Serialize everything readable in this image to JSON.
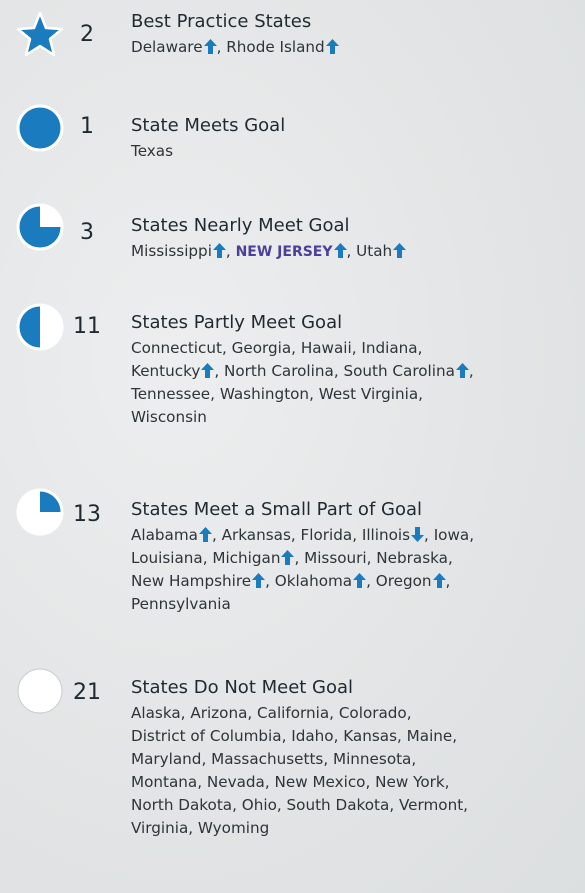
{
  "colors": {
    "accent": "#1a7bbf",
    "highlight": "#4b3f9a",
    "text": "#2d3539"
  },
  "groups": [
    {
      "icon": "star-icon",
      "count": "2",
      "title": "Best Practice States",
      "states": [
        {
          "name": "Delaware",
          "arrow": "up"
        },
        {
          "sep": ", "
        },
        {
          "name": "Rhode Island",
          "arrow": "up"
        }
      ]
    },
    {
      "icon": "full-circle-icon",
      "count": "1",
      "title": "State Meets Goal",
      "states": [
        {
          "name": "Texas"
        }
      ]
    },
    {
      "icon": "three-quarter-circle-icon",
      "count": "3",
      "title": "States Nearly Meet Goal",
      "states": [
        {
          "name": "Mississippi",
          "arrow": "up"
        },
        {
          "sep": ", "
        },
        {
          "name": "NEW JERSEY",
          "arrow": "up",
          "highlight": true
        },
        {
          "sep": ", "
        },
        {
          "name": "Utah",
          "arrow": "up"
        }
      ]
    },
    {
      "icon": "half-circle-icon",
      "count": "11",
      "title": "States Partly Meet Goal",
      "states": [
        {
          "name": "Connecticut"
        },
        {
          "sep": ", "
        },
        {
          "name": "Georgia"
        },
        {
          "sep": ", "
        },
        {
          "name": "Hawaii"
        },
        {
          "sep": ", "
        },
        {
          "name": "Indiana"
        },
        {
          "sep": ","
        },
        {
          "br": true
        },
        {
          "name": "Kentucky",
          "arrow": "up"
        },
        {
          "sep": ", "
        },
        {
          "name": "North Carolina"
        },
        {
          "sep": ", "
        },
        {
          "name": "South Carolina",
          "arrow": "up"
        },
        {
          "sep": ","
        },
        {
          "br": true
        },
        {
          "name": "Tennessee"
        },
        {
          "sep": ", "
        },
        {
          "name": "Washington"
        },
        {
          "sep": ", "
        },
        {
          "name": "West Virginia"
        },
        {
          "sep": ","
        },
        {
          "br": true
        },
        {
          "name": "Wisconsin"
        }
      ]
    },
    {
      "icon": "quarter-circle-icon",
      "count": "13",
      "title": "States Meet a Small Part of Goal",
      "states": [
        {
          "name": "Alabama",
          "arrow": "up"
        },
        {
          "sep": ", "
        },
        {
          "name": "Arkansas"
        },
        {
          "sep": ", "
        },
        {
          "name": "Florida"
        },
        {
          "sep": ", "
        },
        {
          "name": "Illinois",
          "arrow": "down"
        },
        {
          "sep": ", "
        },
        {
          "name": "Iowa"
        },
        {
          "sep": ","
        },
        {
          "br": true
        },
        {
          "name": "Louisiana"
        },
        {
          "sep": ", "
        },
        {
          "name": "Michigan",
          "arrow": "up"
        },
        {
          "sep": ", "
        },
        {
          "name": "Missouri"
        },
        {
          "sep": ", "
        },
        {
          "name": "Nebraska"
        },
        {
          "sep": ","
        },
        {
          "br": true
        },
        {
          "name": "New Hampshire",
          "arrow": "up"
        },
        {
          "sep": ", "
        },
        {
          "name": "Oklahoma",
          "arrow": "up"
        },
        {
          "sep": ", "
        },
        {
          "name": "Oregon",
          "arrow": "up"
        },
        {
          "sep": ","
        },
        {
          "br": true
        },
        {
          "name": "Pennsylvania"
        }
      ]
    },
    {
      "icon": "empty-circle-icon",
      "count": "21",
      "title": "States Do Not Meet Goal",
      "states": [
        {
          "name": "Alaska"
        },
        {
          "sep": ", "
        },
        {
          "name": "Arizona"
        },
        {
          "sep": ", "
        },
        {
          "name": "California"
        },
        {
          "sep": ", "
        },
        {
          "name": "Colorado"
        },
        {
          "sep": ","
        },
        {
          "br": true
        },
        {
          "name": "District of Columbia"
        },
        {
          "sep": ", "
        },
        {
          "name": "Idaho"
        },
        {
          "sep": ", "
        },
        {
          "name": "Kansas"
        },
        {
          "sep": ", "
        },
        {
          "name": "Maine"
        },
        {
          "sep": ","
        },
        {
          "br": true
        },
        {
          "name": "Maryland"
        },
        {
          "sep": ", "
        },
        {
          "name": "Massachusetts"
        },
        {
          "sep": ", "
        },
        {
          "name": "Minnesota"
        },
        {
          "sep": ","
        },
        {
          "br": true
        },
        {
          "name": "Montana"
        },
        {
          "sep": ", "
        },
        {
          "name": "Nevada"
        },
        {
          "sep": ", "
        },
        {
          "name": "New Mexico"
        },
        {
          "sep": ", "
        },
        {
          "name": "New York"
        },
        {
          "sep": ","
        },
        {
          "br": true
        },
        {
          "name": "North Dakota"
        },
        {
          "sep": ", "
        },
        {
          "name": "Ohio"
        },
        {
          "sep": ", "
        },
        {
          "name": "South Dakota"
        },
        {
          "sep": ", "
        },
        {
          "name": "Vermont"
        },
        {
          "sep": ","
        },
        {
          "br": true
        },
        {
          "name": "Virginia"
        },
        {
          "sep": ", "
        },
        {
          "name": "Wyoming"
        }
      ]
    }
  ]
}
